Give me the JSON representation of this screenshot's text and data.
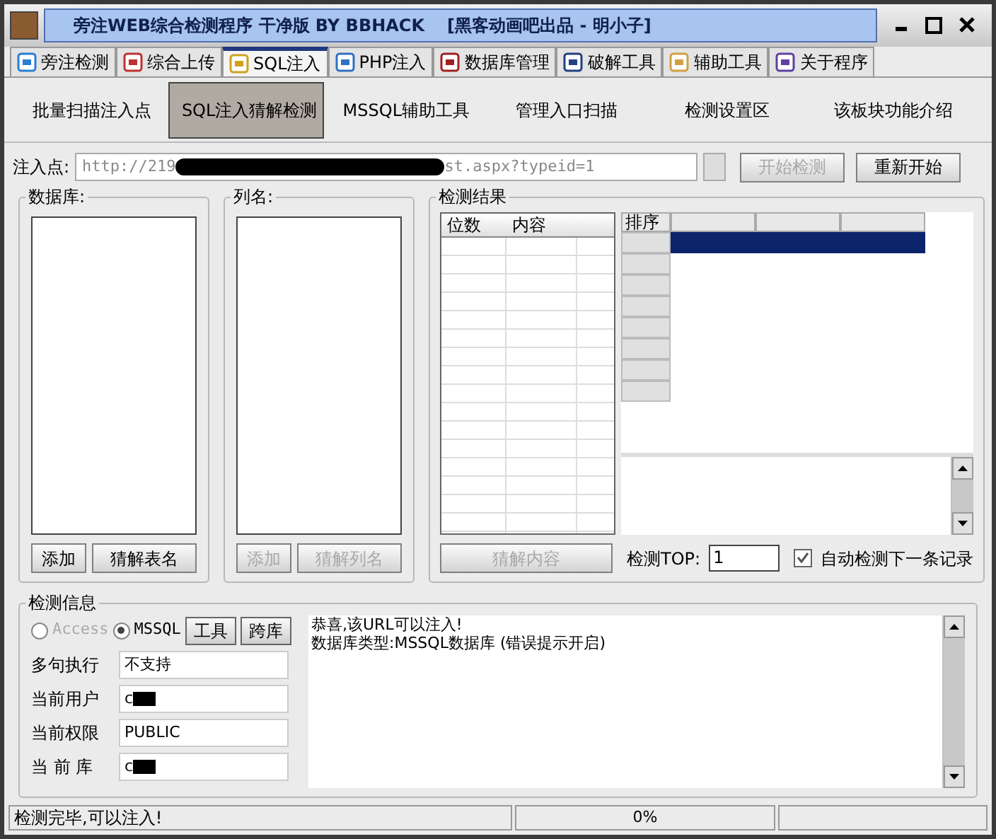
{
  "window": {
    "title": "旁注WEB综合检测程序 干净版 BY BBHACK",
    "title_extra": "[黑客动画吧出品 - 明小子]"
  },
  "tabs": [
    {
      "label": "旁注检测",
      "selected": false
    },
    {
      "label": "综合上传",
      "selected": false
    },
    {
      "label": "SQL注入",
      "selected": true
    },
    {
      "label": "PHP注入",
      "selected": false
    },
    {
      "label": "数据库管理",
      "selected": false
    },
    {
      "label": "破解工具",
      "selected": false
    },
    {
      "label": "辅助工具",
      "selected": false
    },
    {
      "label": "关于程序",
      "selected": false
    }
  ],
  "subtabs": [
    {
      "label": "批量扫描注入点",
      "selected": false
    },
    {
      "label": "SQL注入猜解检测",
      "selected": true
    },
    {
      "label": "MSSQL辅助工具",
      "selected": false
    },
    {
      "label": "管理入口扫描",
      "selected": false
    },
    {
      "label": "检测设置区",
      "selected": false
    },
    {
      "label": "该板块功能介绍",
      "selected": false
    }
  ],
  "url": {
    "label": "注入点:",
    "value_start": "http://219",
    "value_end": "st.aspx?typeid=1",
    "redacted": true
  },
  "buttons": [
    {
      "label": "开始检测",
      "disabled": true
    },
    {
      "label": "重新开始",
      "disabled": false
    }
  ],
  "database_panel": {
    "title": "数据库:",
    "buttons": [
      {
        "label": "添加",
        "disabled": false
      },
      {
        "label": "猜解表名",
        "disabled": false
      }
    ]
  },
  "column_panel": {
    "title": "列名:",
    "buttons": [
      {
        "label": "添加",
        "disabled": true
      },
      {
        "label": "猜解列名",
        "disabled": true
      }
    ]
  },
  "results_panel": {
    "title": "检测结果",
    "columns": [
      "位数",
      "内容"
    ],
    "grid_header": "排序",
    "grid_rows": [
      {
        "selected": true
      },
      {
        "selected": false
      },
      {
        "selected": false
      },
      {
        "selected": false
      },
      {
        "selected": false
      },
      {
        "selected": false
      },
      {
        "selected": false
      },
      {
        "selected": false
      }
    ],
    "button": {
      "label": "猜解内容",
      "disabled": true
    },
    "top_label": "检测TOP:",
    "top_value": "1",
    "auto_next": {
      "label": "自动检测下一条记录",
      "checked": true
    }
  },
  "info_panel": {
    "title": "检测信息",
    "db_types": [
      {
        "label": "Access",
        "selected": false,
        "disabled": true
      },
      {
        "label": "MSSQL",
        "selected": true,
        "disabled": false
      }
    ],
    "tool_buttons": [
      "工具",
      "跨库"
    ],
    "fields": [
      {
        "label": "多句执行",
        "value": "不支持"
      },
      {
        "label": "当前用户",
        "value": "c",
        "redacted": true
      },
      {
        "label": "当前权限",
        "value": "PUBLIC"
      },
      {
        "label": "当 前 库",
        "value": "c",
        "redacted": true
      }
    ],
    "log": [
      "恭喜,该URL可以注入!",
      "数据库类型:MSSQL数据库 (错误提示开启)"
    ]
  },
  "status_bar": {
    "message": "检测完毕,可以注入!",
    "progress": "0%",
    "level": 0
  }
}
